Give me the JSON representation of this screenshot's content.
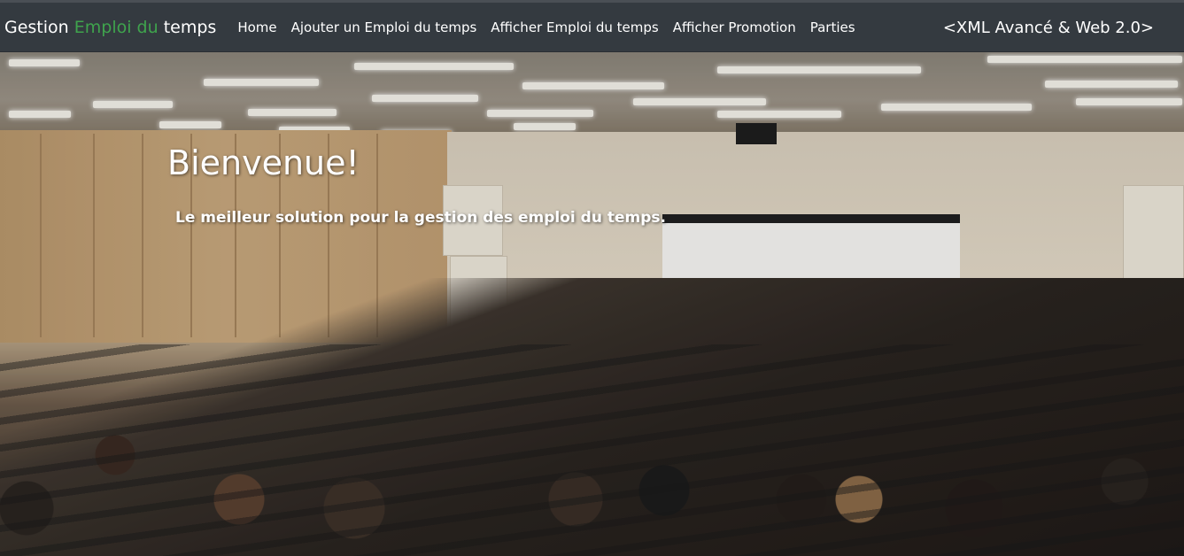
{
  "navbar": {
    "brand": {
      "part1": "Gestion ",
      "accent": "Emploi du",
      "part2": " temps",
      "accent_color": "#3fa34d"
    },
    "links": [
      {
        "label": "Home"
      },
      {
        "label": "Ajouter un Emploi du temps"
      },
      {
        "label": "Afficher Emploi du temps"
      },
      {
        "label": "Afficher Promotion"
      },
      {
        "label": "Parties"
      }
    ],
    "right_text": "<XML Avancé & Web 2.0>",
    "background": "#343a40"
  },
  "hero": {
    "title": "Bienvenue!",
    "subtitle": "Le meilleur solution pour la gestion des emploi du temps.",
    "image_subject": "lecture-hall-photo"
  }
}
